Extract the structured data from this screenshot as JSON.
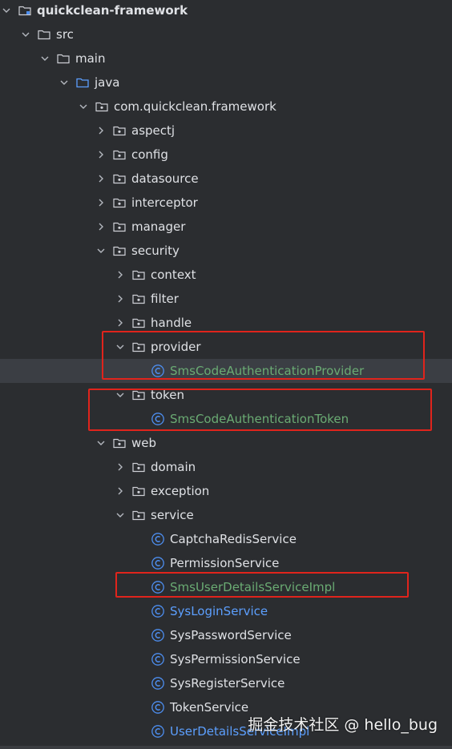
{
  "colors": {
    "background": "#2b2d30",
    "text": "#dfe1e5",
    "class_icon": "#4d8ef0",
    "vcs_green": "#6aab73",
    "vcs_blue": "#5c9ffe",
    "highlight_box": "#e0241c"
  },
  "tree": [
    {
      "label": "quickclean-framework",
      "icon": "module-folder-icon",
      "expanded": true,
      "root": true
    },
    {
      "label": "src",
      "icon": "folder-icon",
      "expanded": true
    },
    {
      "label": "main",
      "icon": "folder-icon",
      "expanded": true
    },
    {
      "label": "java",
      "icon": "source-folder-icon",
      "expanded": true
    },
    {
      "label": "com.quickclean.framework",
      "icon": "package-icon",
      "expanded": true
    },
    {
      "label": "aspectj",
      "icon": "package-icon",
      "expanded": false
    },
    {
      "label": "config",
      "icon": "package-icon",
      "expanded": false
    },
    {
      "label": "datasource",
      "icon": "package-icon",
      "expanded": false
    },
    {
      "label": "interceptor",
      "icon": "package-icon",
      "expanded": false
    },
    {
      "label": "manager",
      "icon": "package-icon",
      "expanded": false
    },
    {
      "label": "security",
      "icon": "package-icon",
      "expanded": true
    },
    {
      "label": "context",
      "icon": "package-icon",
      "expanded": false
    },
    {
      "label": "filter",
      "icon": "package-icon",
      "expanded": false
    },
    {
      "label": "handle",
      "icon": "package-icon",
      "expanded": false
    },
    {
      "label": "provider",
      "icon": "package-icon",
      "expanded": true
    },
    {
      "label": "SmsCodeAuthenticationProvider",
      "icon": "class-icon",
      "status": "added",
      "selected": true
    },
    {
      "label": "token",
      "icon": "package-icon",
      "expanded": true
    },
    {
      "label": "SmsCodeAuthenticationToken",
      "icon": "class-icon",
      "status": "added"
    },
    {
      "label": "web",
      "icon": "package-icon",
      "expanded": true
    },
    {
      "label": "domain",
      "icon": "package-icon",
      "expanded": false
    },
    {
      "label": "exception",
      "icon": "package-icon",
      "expanded": false
    },
    {
      "label": "service",
      "icon": "package-icon",
      "expanded": true
    },
    {
      "label": "CaptchaRedisService",
      "icon": "class-icon"
    },
    {
      "label": "PermissionService",
      "icon": "class-icon"
    },
    {
      "label": "SmsUserDetailsServiceImpl",
      "icon": "class-icon",
      "status": "added"
    },
    {
      "label": "SysLoginService",
      "icon": "class-icon",
      "status": "modified"
    },
    {
      "label": "SysPasswordService",
      "icon": "class-icon"
    },
    {
      "label": "SysPermissionService",
      "icon": "class-icon"
    },
    {
      "label": "SysRegisterService",
      "icon": "class-icon"
    },
    {
      "label": "TokenService",
      "icon": "class-icon"
    },
    {
      "label": "UserDetailsServiceImpl",
      "icon": "class-icon",
      "status": "modified"
    }
  ],
  "watermark": "掘金技术社区 @ hello_bug"
}
